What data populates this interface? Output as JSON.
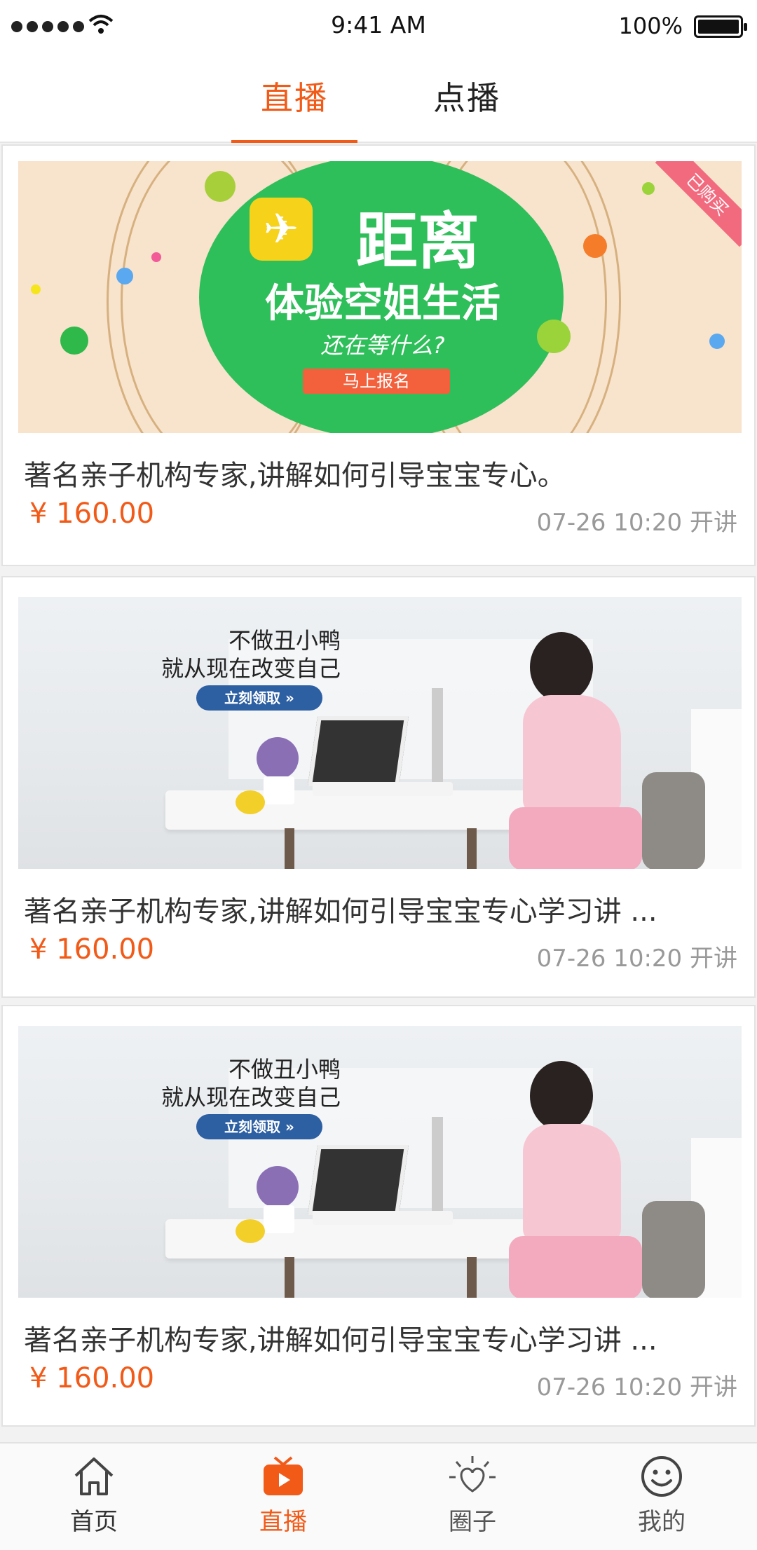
{
  "status_bar": {
    "time": "9:41 AM",
    "battery": "100%",
    "icons": [
      "signal-dots-icon",
      "wifi-icon",
      "battery-icon"
    ]
  },
  "tabs": [
    {
      "label": "直播",
      "active": true
    },
    {
      "label": "点播",
      "active": false
    }
  ],
  "colors": {
    "accent": "#f25a18",
    "card_border": "#e2e2e2",
    "text": "#333333",
    "muted": "#999999"
  },
  "cards": [
    {
      "banner": {
        "headline": "距离",
        "subline": "体验空姐生活",
        "question": "还在等什么?",
        "button": "马上报名",
        "ribbon": "已购买"
      },
      "title": "著名亲子机构专家,讲解如何引导宝宝专心。",
      "price": "¥ 160.00",
      "date": "07-26  10:20 开讲"
    },
    {
      "banner": {
        "line1": "不做丑小鸭",
        "line2": "就从现在改变自己",
        "button": "立刻领取 »"
      },
      "title": "著名亲子机构专家,讲解如何引导宝宝专心学习讲 ...",
      "price": "¥ 160.00",
      "date": "07-26  10:20 开讲"
    },
    {
      "banner": {
        "line1": "不做丑小鸭",
        "line2": "就从现在改变自己",
        "button": "立刻领取 »"
      },
      "title": "著名亲子机构专家,讲解如何引导宝宝专心学习讲 ...",
      "price": "¥ 160.00",
      "date": "07-26  10:20 开讲"
    }
  ],
  "bottom_nav": [
    {
      "label": "首页",
      "icon": "home-icon",
      "active": false
    },
    {
      "label": "直播",
      "icon": "tv-play-icon",
      "active": true
    },
    {
      "label": "圈子",
      "icon": "sun-heart-icon",
      "active": false
    },
    {
      "label": "我的",
      "icon": "smiley-icon",
      "active": false
    }
  ]
}
